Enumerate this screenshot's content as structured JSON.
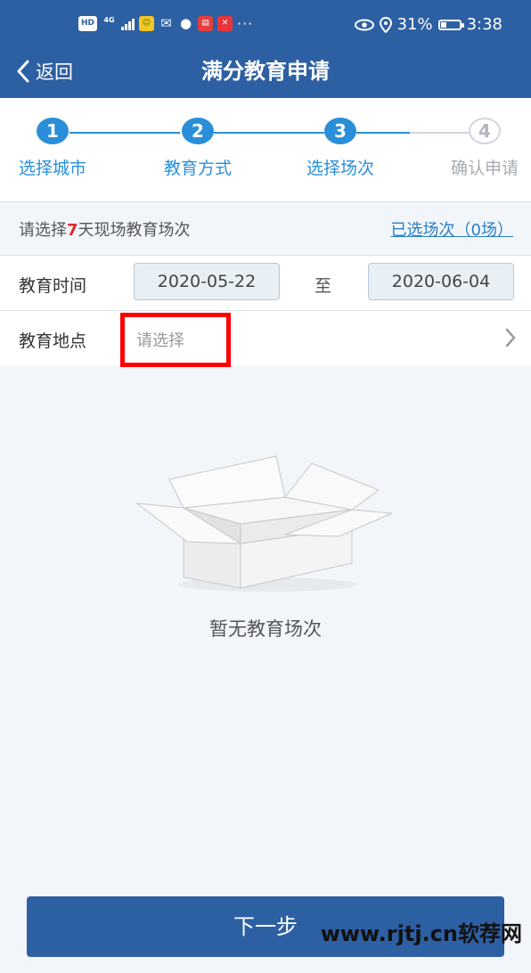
{
  "status_bar": {
    "hd": "HD",
    "network": "4G",
    "more": "···",
    "battery": "31%",
    "time": "3:38",
    "battery_level": 0.31
  },
  "header": {
    "back_label": "返回",
    "title": "满分教育申请"
  },
  "steps": [
    {
      "number": "1",
      "label": "选择城市",
      "active": true
    },
    {
      "number": "2",
      "label": "教育方式",
      "active": true
    },
    {
      "number": "3",
      "label": "选择场次",
      "active": true
    },
    {
      "number": "4",
      "label": "确认申请",
      "active": false
    }
  ],
  "select_bar": {
    "hint_prefix": "请选择",
    "hint_number": "7",
    "hint_suffix": "天现场教育场次",
    "selected_link": "已选场次（0场）"
  },
  "time_row": {
    "label": "教育时间",
    "start_date": "2020-05-22",
    "separator": "至",
    "end_date": "2020-06-04"
  },
  "location_row": {
    "label": "教育地点",
    "placeholder": "请选择"
  },
  "empty_state": {
    "text": "暂无教育场次"
  },
  "footer": {
    "next_label": "下一步"
  },
  "watermark": "www.rjtj.cn软荐网",
  "colors": {
    "header": "#2d5fa3",
    "step_active": "#2a8fd8",
    "highlight": "#ff0000",
    "hint_number": "#e02a2a"
  }
}
